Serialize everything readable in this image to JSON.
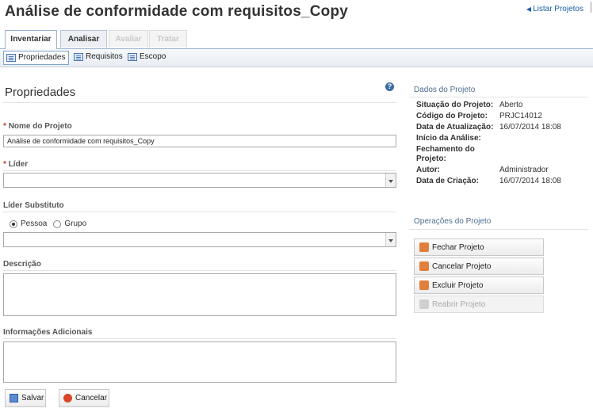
{
  "page": {
    "title": "Análise de conformidade com requisitos_Copy",
    "list_link": "Listar Projetos"
  },
  "tabs": [
    "Inventariar",
    "Analisar",
    "Avaliar",
    "Tratar"
  ],
  "subtabs": [
    "Propriedades",
    "Requisitos",
    "Escopo"
  ],
  "form": {
    "heading": "Propriedades",
    "nome_label": "Nome do Projeto",
    "nome_value": "Análise de conformidade com requisitos_Copy",
    "lider_label": "Líder",
    "lider_sub_label": "Líder Substituto",
    "radio_pessoa": "Pessoa",
    "radio_grupo": "Grupo",
    "descricao_label": "Descrição",
    "info_label": "Informações Adicionais",
    "required_mark": "*",
    "save_label": "Salvar",
    "cancel_label": "Cancelar"
  },
  "dados": {
    "title": "Dados do Projeto",
    "rows": [
      {
        "k": "Situação do Projeto:",
        "v": "Aberto"
      },
      {
        "k": "Código do Projeto:",
        "v": "PRJC14012"
      },
      {
        "k": "Data de Atualização:",
        "v": "16/07/2014 18:08"
      },
      {
        "k": "Início da Análise:",
        "v": ""
      },
      {
        "k": "Fechamento do Projeto:",
        "v": ""
      },
      {
        "k": "Autor:",
        "v": "Administrador"
      },
      {
        "k": "Data de Criação:",
        "v": "16/07/2014 18:08"
      }
    ]
  },
  "operacoes": {
    "title": "Operações do Projeto",
    "items": [
      "Fechar Projeto",
      "Cancelar Projeto",
      "Excluir Projeto",
      "Reabrir Projeto"
    ]
  },
  "colors": {
    "accent": "#1a5fa8",
    "required": "#c0392b",
    "op_icon": "#e0803a"
  }
}
